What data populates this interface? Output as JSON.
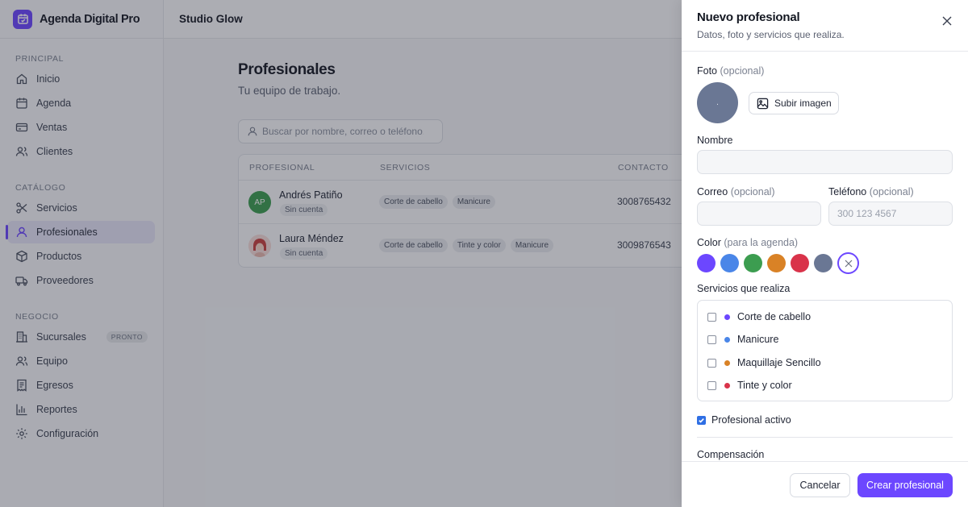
{
  "brand": {
    "name": "Agenda Digital Pro",
    "logo_icon": "calendar-icon",
    "color": "#6c47ff"
  },
  "topbar": {
    "workspace": "Studio Glow"
  },
  "sidebar": {
    "sections": [
      {
        "title": "PRINCIPAL",
        "items": [
          {
            "label": "Inicio",
            "icon": "home-icon"
          },
          {
            "label": "Agenda",
            "icon": "calendar-icon"
          },
          {
            "label": "Ventas",
            "icon": "credit-card-icon"
          },
          {
            "label": "Clientes",
            "icon": "users-icon"
          }
        ]
      },
      {
        "title": "CATÁLOGO",
        "items": [
          {
            "label": "Servicios",
            "icon": "scissors-icon"
          },
          {
            "label": "Profesionales",
            "icon": "user-icon",
            "active": true
          },
          {
            "label": "Productos",
            "icon": "box-icon"
          },
          {
            "label": "Proveedores",
            "icon": "truck-icon"
          }
        ]
      },
      {
        "title": "NEGOCIO",
        "items": [
          {
            "label": "Sucursales",
            "icon": "building-icon",
            "badge": "PRONTO"
          },
          {
            "label": "Equipo",
            "icon": "team-icon"
          },
          {
            "label": "Egresos",
            "icon": "receipt-icon"
          },
          {
            "label": "Reportes",
            "icon": "bar-chart-icon"
          },
          {
            "label": "Configuración",
            "icon": "gear-icon"
          }
        ]
      }
    ]
  },
  "main": {
    "title": "Profesionales",
    "subtitle": "Tu equipo de trabajo.",
    "search_placeholder": "Buscar por nombre, correo o teléfono...",
    "table": {
      "columns": [
        "PROFESIONAL",
        "SERVICIOS",
        "CONTACTO"
      ],
      "rows": [
        {
          "name": "Andrés Patiño",
          "initials": "AP",
          "tag": "Sin cuenta",
          "services": [
            "Corte de cabello",
            "Manicure"
          ],
          "contact": "3008765432"
        },
        {
          "name": "Laura Méndez",
          "tag": "Sin cuenta",
          "services": [
            "Corte de cabello",
            "Tinte y color",
            "Manicure"
          ],
          "contact": "3009876543"
        }
      ]
    }
  },
  "drawer": {
    "title": "Nuevo profesional",
    "subtitle": "Datos, foto y servicios que realiza.",
    "photo": {
      "label": "Foto",
      "optional": "(opcional)",
      "placeholder": ".",
      "upload_label": "Subir imagen"
    },
    "name": {
      "label": "Nombre",
      "value": ""
    },
    "email": {
      "label": "Correo",
      "optional": "(opcional)",
      "value": ""
    },
    "phone": {
      "label": "Teléfono",
      "optional": "(opcional)",
      "placeholder": "300 123 4567"
    },
    "color": {
      "label": "Color",
      "optional": "(para la agenda)",
      "options": [
        "#6c47ff",
        "#4a86e8",
        "#3c9d50",
        "#d98226",
        "#d9334a",
        "#6a7794"
      ],
      "selected": "none"
    },
    "services": {
      "label": "Servicios que realiza",
      "items": [
        {
          "label": "Corte de cabello",
          "color": "#6c47ff",
          "checked": false
        },
        {
          "label": "Manicure",
          "color": "#4a86e8",
          "checked": false
        },
        {
          "label": "Maquillaje Sencillo",
          "color": "#d98226",
          "checked": false
        },
        {
          "label": "Tinte y color",
          "color": "#d9334a",
          "checked": false
        }
      ]
    },
    "active": {
      "label": "Profesional activo",
      "checked": true
    },
    "compensation": {
      "label": "Compensación"
    },
    "buttons": {
      "cancel": "Cancelar",
      "create": "Crear profesional"
    }
  }
}
